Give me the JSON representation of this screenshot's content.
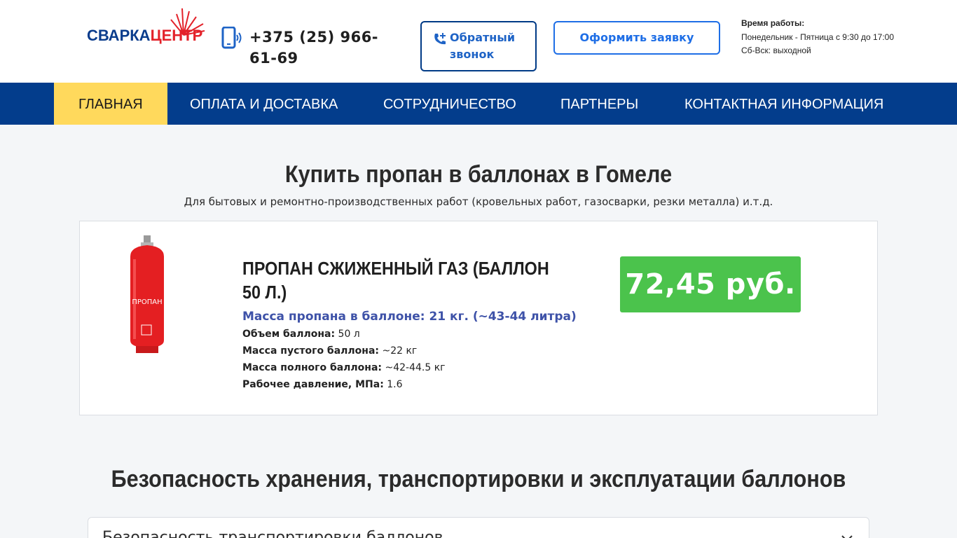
{
  "header": {
    "logo_text": "СВАРКАЦЕНТР",
    "phone": "+375 (25) 966-61-69",
    "callback_label": "Обратный звонок",
    "order_label": "Оформить заявку",
    "hours_title": "Время работы:",
    "hours_weekdays": "Понедельник - Пятница с 9:30 до 17:00",
    "hours_weekend": "Сб-Вск: выходной"
  },
  "nav": {
    "items": [
      {
        "label": "Главная"
      },
      {
        "label": "Оплата и доставка"
      },
      {
        "label": "Сотрудничество"
      },
      {
        "label": "Партнеры"
      },
      {
        "label": "Контактная информация"
      }
    ]
  },
  "hero": {
    "title": "Купить пропан в баллонах в Гомеле",
    "subtitle": "Для бытовых и ремонтно-производственных работ (кровельных работ, газосварки, резки металла) и.т.д."
  },
  "product": {
    "cylinder_label": "ПРОПАН",
    "title": "ПРОПАН СЖИЖЕННЫЙ ГАЗ (БАЛЛОН 50 Л.)",
    "mass_line": "Масса пропана в баллоне: 21 кг. (~43-44 литра)",
    "specs": [
      {
        "key": "Объем баллона:",
        "value": "50 л"
      },
      {
        "key": "Масса пустого баллона:",
        "value": "~22 кг"
      },
      {
        "key": "Масса полного баллона:",
        "value": "~42-44.5 кг"
      },
      {
        "key": "Рабочее давление, МПа:",
        "value": "1.6"
      }
    ],
    "price": "72,45 руб."
  },
  "safety": {
    "title": "Безопасность хранения, транспортировки и эксплуатации баллонов",
    "accordion_label": "Безопасность транспортировки баллонов"
  },
  "colors": {
    "nav_bg": "#033d8c",
    "nav_active": "#ffd95c",
    "price_bg": "#4bc34c",
    "accent_blue": "#1e6ee6",
    "logo_red": "#e3222a",
    "logo_blue": "#0a3c8c"
  },
  "icons": {
    "phone": "mobile-phone-icon",
    "callback": "phone-plus-icon",
    "accordion": "chevron-down-icon"
  }
}
